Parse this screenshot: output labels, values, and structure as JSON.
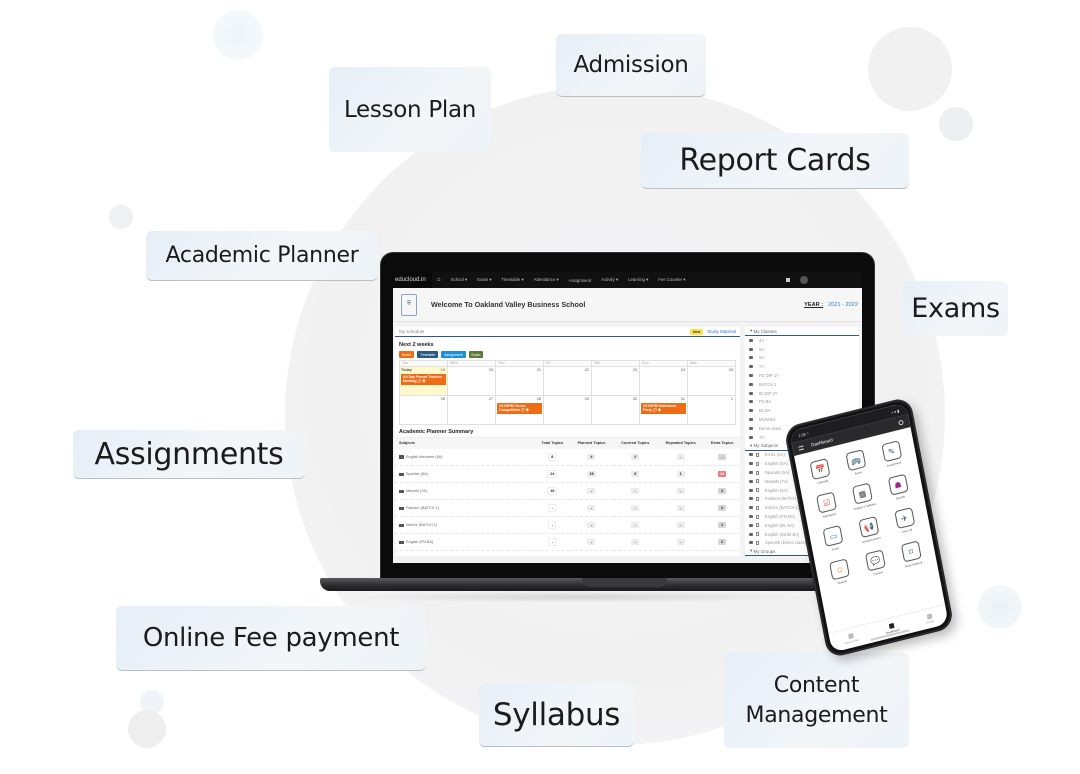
{
  "features": {
    "lesson_plan": "Lesson Plan",
    "admission": "Admission",
    "report_cards": "Report Cards",
    "academic_planner": "Academic Planner",
    "exams": "Exams",
    "assignments": "Assignments",
    "online_fee": "Online Fee payment",
    "syllabus": "Syllabus",
    "content_line1": "Content",
    "content_line2": "Management"
  },
  "app": {
    "brand": "educloud.in",
    "nav": [
      {
        "label": "School ▾"
      },
      {
        "label": "Exam ▾"
      },
      {
        "label": "Timetable ▾"
      },
      {
        "label": "Attendance ▾"
      },
      {
        "label": "Assignment"
      },
      {
        "label": "Activity ▾"
      },
      {
        "label": "Learning ▾"
      },
      {
        "label": "Fee Counter ▾"
      }
    ],
    "home_icon": "home-icon",
    "welcome": "Welcome To Oakland Valley Business School",
    "year_label": "YEAR :",
    "year_value": "2021 - 2022",
    "colors": {
      "event": "#ef6c16",
      "timetable": "#2b5a80",
      "assignment": "#1e90d8",
      "exam": "#5e7a3a",
      "accent_link": "#2a7bd4",
      "extra_high": "#f07a7a"
    }
  },
  "schedule": {
    "title": "My schedule",
    "new_badge": "New",
    "study_material": "Study Material",
    "range_title": "Next 2 weeks",
    "legend": [
      {
        "label": "Event"
      },
      {
        "label": "Timetable"
      },
      {
        "label": "Assignment"
      },
      {
        "label": "Exam"
      }
    ],
    "days": [
      "Tue",
      "Wed",
      "Thu",
      "Fri",
      "Sat",
      "Sun",
      "Mon"
    ],
    "today_label": "Today",
    "week1": [
      "19",
      "20",
      "21",
      "22",
      "23",
      "24",
      "25"
    ],
    "week2": [
      "26",
      "27",
      "28",
      "29",
      "30",
      "31",
      "1"
    ],
    "events": {
      "w1_tue": "All Day Parent Teacher Meeting ⓘ ✚",
      "w2_thu": "12:00PM Chess Competition ⓘ ✚",
      "w2_sun": "12:00PM Halloween Party ⓘ ✚"
    }
  },
  "planner": {
    "title": "Academic Planner Summary",
    "columns": [
      "Subjects",
      "Total Topics",
      "Planned Topics",
      "Covered Topics",
      "Repeated Topics",
      "Extra Topics"
    ],
    "rows": [
      {
        "subject": "English literature (5A)",
        "total": "8",
        "planned": "4",
        "covered": "2",
        "repeated": "-",
        "extra": "-"
      },
      {
        "subject": "Spanish (5A)",
        "total": "24",
        "planned": "15",
        "covered": "9",
        "repeated": "1",
        "extra": "14"
      },
      {
        "subject": "Marathi (7A)",
        "total": "16",
        "planned": "-",
        "covered": "-",
        "repeated": "-",
        "extra": "2"
      },
      {
        "subject": "Fashion (BATCH 1)",
        "total": "-",
        "planned": "-",
        "covered": "-",
        "repeated": "-",
        "extra": "2"
      },
      {
        "subject": "Interior (BATCH 1)",
        "total": "-",
        "planned": "-",
        "covered": "-",
        "repeated": "-",
        "extra": "1"
      },
      {
        "subject": "English (FN BA)",
        "total": "-",
        "planned": "-",
        "covered": "-",
        "repeated": "-",
        "extra": "2"
      }
    ]
  },
  "sidebar": {
    "classes_title": "My Classes",
    "classes": [
      "4A",
      "5A",
      "5A",
      "7A",
      "FD DIP 1Y",
      "BATCH 1",
      "ID DIP 2Y",
      "FN BA",
      "BL BA",
      "MUM BA",
      "Demo class",
      "7A"
    ],
    "subjects_title": "My Subjects",
    "subjects": [
      "EVS1 (4A)",
      "English (5A)",
      "Spanish (5A)",
      "Marathi (7A)",
      "English (5A)",
      "Fashion (BATCH 1)",
      "Interior (BATCH 1)",
      "English (FN BA)",
      "English (BL BA)",
      "English (MUM BA)",
      "Spanish (Demo class)"
    ],
    "groups_title": "My Groups"
  },
  "phone": {
    "time": "1:05 ⁴",
    "status_icons": "▪ ▾ ▮",
    "title": "Dashboard",
    "tiles": [
      {
        "label": "Calendar",
        "icon": "📅",
        "name": "calendar-icon"
      },
      {
        "label": "Event",
        "icon": "🚌",
        "name": "event-icon"
      },
      {
        "label": "Assignment",
        "icon": "✎",
        "name": "assignment-icon"
      },
      {
        "label": "Attendance",
        "icon": "☑",
        "name": "attendance-icon"
      },
      {
        "label": "Subject & Syllabus",
        "icon": "▦",
        "name": "syllabus-icon"
      },
      {
        "label": "Teacher",
        "icon": "☗",
        "name": "teacher-icon"
      },
      {
        "label": "Exam",
        "icon": "▭",
        "name": "exam-icon"
      },
      {
        "label": "Announcement",
        "icon": "📢",
        "name": "announcement-icon"
      },
      {
        "label": "Time Off",
        "icon": "✈",
        "name": "time-off-icon"
      },
      {
        "label": "Student",
        "icon": "☺",
        "name": "student-icon"
      },
      {
        "label": "Connect",
        "icon": "💬",
        "name": "connect-icon"
      },
      {
        "label": "Study Material",
        "icon": "⌑",
        "name": "study-material-icon"
      }
    ],
    "tabs": [
      {
        "label": "Search Film"
      },
      {
        "label": "Dashboard"
      },
      {
        "label": "Profile"
      }
    ]
  }
}
